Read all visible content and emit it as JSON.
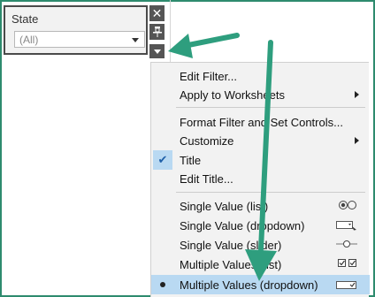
{
  "filter": {
    "title": "State",
    "value": "(All)"
  },
  "controls": {
    "close_symbol": "✕",
    "pin_symbol": "⊥"
  },
  "menu": {
    "items": [
      {
        "label": "Edit Filter...",
        "submenu": false
      },
      {
        "label": "Apply to Worksheets",
        "submenu": true
      },
      {
        "label": "Format Filter and Set Controls...",
        "submenu": false
      },
      {
        "label": "Customize",
        "submenu": true
      },
      {
        "label": "Title",
        "checked": true
      },
      {
        "label": "Edit Title...",
        "submenu": false
      },
      {
        "label": "Single Value (list)",
        "icon": "radio-buttons-icon"
      },
      {
        "label": "Single Value (dropdown)",
        "icon": "dropdown-icon"
      },
      {
        "label": "Single Value (slider)",
        "icon": "slider-icon"
      },
      {
        "label": "Multiple Values (list)",
        "icon": "checkboxes-icon"
      },
      {
        "label": "Multiple Values (dropdown)",
        "icon": "checkbox-dropdown-icon",
        "selected": true
      }
    ]
  },
  "colors": {
    "accent_arrow": "#2e9e7e",
    "selection": "#b9d9f2",
    "frame": "#2e8b6e"
  }
}
